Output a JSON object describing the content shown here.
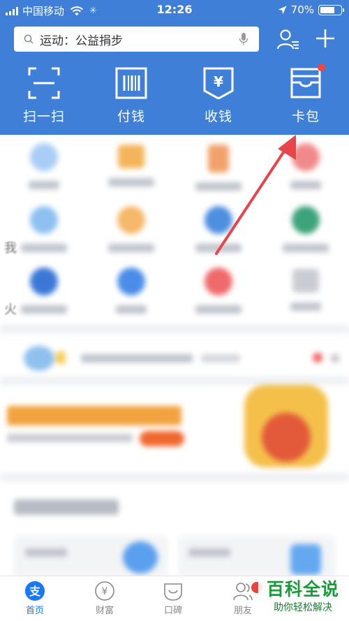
{
  "status_bar": {
    "carrier": "中国移动",
    "time": "12:26",
    "battery": "70%"
  },
  "search": {
    "value": "运动：公益捐步"
  },
  "quick_actions": [
    {
      "label": "扫一扫",
      "icon": "scan-icon"
    },
    {
      "label": "付钱",
      "icon": "pay-code-icon"
    },
    {
      "label": "收钱",
      "icon": "receive-money-icon"
    },
    {
      "label": "卡包",
      "icon": "card-wallet-icon",
      "badge": true
    }
  ],
  "tab_bar": [
    {
      "label": "首页",
      "icon": "home-alipay-icon",
      "active": true
    },
    {
      "label": "财富",
      "icon": "wealth-icon",
      "active": false
    },
    {
      "label": "口碑",
      "icon": "koubei-icon",
      "active": false
    },
    {
      "label": "朋友",
      "icon": "friends-icon",
      "active": false
    },
    {
      "label": "",
      "icon": "mine-icon",
      "active": false
    }
  ],
  "partial_text": {
    "left_char_1": "我",
    "left_char_2": "火"
  },
  "watermark": {
    "title": "百科全说",
    "subtitle": "助你轻松解决"
  },
  "colors": {
    "header_blue": "#3f7fd8",
    "badge_red": "#f2453e",
    "active_tab": "#1677ff",
    "arrow_red": "#e8454a",
    "watermark_green": "#1a9a3a"
  }
}
